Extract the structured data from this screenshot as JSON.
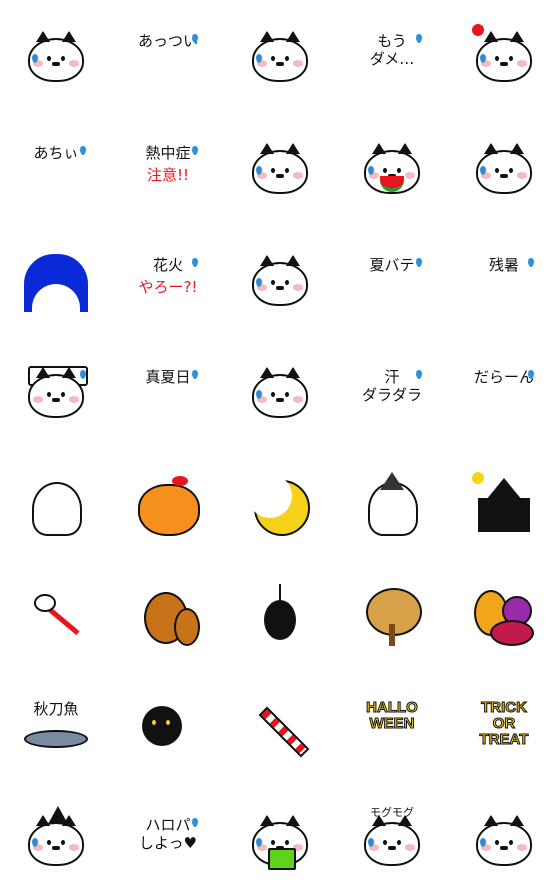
{
  "stickers": [
    {
      "kind": "cat",
      "icon": "sweating-cat-icon",
      "text": ""
    },
    {
      "kind": "text",
      "icon": "hot-text-icon",
      "text": "あっつい"
    },
    {
      "kind": "cat",
      "icon": "melting-cat-icon",
      "text": ""
    },
    {
      "kind": "text",
      "icon": "exhausted-text-icon",
      "text": "もう\nダメ…"
    },
    {
      "kind": "cat",
      "icon": "sun-cat-icon",
      "text": ""
    },
    {
      "kind": "text",
      "icon": "hot-text-icon",
      "text": "あちぃ"
    },
    {
      "kind": "text",
      "icon": "heatstroke-warning-icon",
      "text": "熱中症",
      "text2": "注意!!"
    },
    {
      "kind": "cat",
      "icon": "ice-cream-cat-icon",
      "text": ""
    },
    {
      "kind": "cat",
      "icon": "watermelon-cat-icon",
      "text": ""
    },
    {
      "kind": "cat",
      "icon": "ice-cream-cat-icon",
      "text": ""
    },
    {
      "kind": "fireworks",
      "icon": "fireworks-icon",
      "text": ""
    },
    {
      "kind": "text",
      "icon": "fireworks-invite-icon",
      "text": "花火",
      "text2": "やろー?!"
    },
    {
      "kind": "cat",
      "icon": "sunglasses-cat-icon",
      "text": ""
    },
    {
      "kind": "text",
      "icon": "summer-fatigue-icon",
      "text": "夏バテ"
    },
    {
      "kind": "text",
      "icon": "lingering-heat-icon",
      "text": "残暑"
    },
    {
      "kind": "text",
      "icon": "air-conditioner-cat-icon",
      "text": ""
    },
    {
      "kind": "text",
      "icon": "midsummer-day-icon",
      "text": "真夏日"
    },
    {
      "kind": "cat",
      "icon": "sweating-cat-icon",
      "text": ""
    },
    {
      "kind": "text",
      "icon": "dripping-sweat-icon",
      "text": "汗\nダラダラ"
    },
    {
      "kind": "text",
      "icon": "limp-cat-icon",
      "text": "だらーん"
    },
    {
      "kind": "ghost",
      "icon": "ghost-icon",
      "text": ""
    },
    {
      "kind": "pumpkin",
      "icon": "pumpkin-icon",
      "text": ""
    },
    {
      "kind": "moon",
      "icon": "moon-bat-icon",
      "text": ""
    },
    {
      "kind": "ghost",
      "icon": "witch-ghost-icon",
      "text": ""
    },
    {
      "kind": "house",
      "icon": "haunted-house-icon",
      "text": ""
    },
    {
      "kind": "dragonfly",
      "icon": "dragonfly-icon",
      "text": ""
    },
    {
      "kind": "squirrel",
      "icon": "squirrel-icon",
      "text": ""
    },
    {
      "kind": "spider",
      "icon": "spider-icon",
      "text": ""
    },
    {
      "kind": "tree",
      "icon": "autumn-tree-icon",
      "text": ""
    },
    {
      "kind": "fruit",
      "icon": "autumn-fruits-icon",
      "text": ""
    },
    {
      "kind": "fish",
      "icon": "saury-icon",
      "text": "秋刀魚"
    },
    {
      "kind": "blackcat",
      "icon": "black-cat-icon",
      "text": ""
    },
    {
      "kind": "candy",
      "icon": "candy-icon",
      "text": ""
    },
    {
      "kind": "logo",
      "icon": "halloween-text-icon",
      "text": "HALLO\nWEEN"
    },
    {
      "kind": "logo",
      "icon": "trick-or-treat-text-icon",
      "text": "TRICK\nOR\nTREAT"
    },
    {
      "kind": "cat",
      "icon": "witch-hat-cat-icon",
      "text": ""
    },
    {
      "kind": "text",
      "icon": "halloween-party-icon",
      "text": "ハロパ\nしよっ♥"
    },
    {
      "kind": "cat",
      "icon": "reading-cat-icon",
      "text": ""
    },
    {
      "kind": "cat",
      "icon": "eating-cat-icon",
      "text": "モグモグ"
    },
    {
      "kind": "cat",
      "icon": "sweating-cat-icon",
      "text": ""
    }
  ],
  "colors": {
    "sweat": "#2f8fd8",
    "cheek": "#f9b9c0",
    "red": "#e8151d",
    "pumpkin": "#f5901e",
    "moon": "#f7d21a",
    "halloween": "#f7c91a"
  }
}
